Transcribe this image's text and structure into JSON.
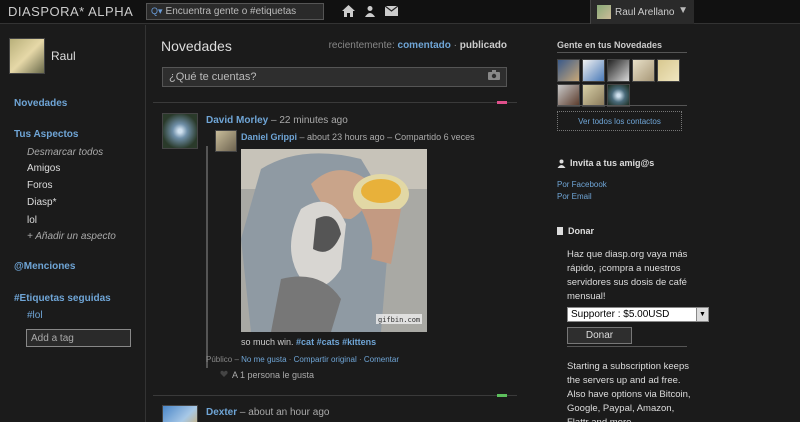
{
  "header": {
    "brand": "DIASPORA* ALPHA",
    "search_placeholder": "Encuentra gente o #etiquetas",
    "user_name": "Raul Arellano"
  },
  "left": {
    "profile_name": "Raul",
    "nav_stream": "Novedades",
    "aspects_title": "Tus Aspectos",
    "deselect_all": "Desmarcar todos",
    "aspects": [
      "Amigos",
      "Foros",
      "Diasp*",
      "lol"
    ],
    "add_aspect": "+ Añadir un aspecto",
    "mentions": "@Menciones",
    "followed_tags_title": "#Etiquetas seguidas",
    "followed_tag": "#lol",
    "add_tag_placeholder": "Add a tag"
  },
  "main": {
    "title": "Novedades",
    "sort_label": "recientemente:",
    "sort_commented": "comentado",
    "sort_sep": "·",
    "sort_published": "publicado",
    "composer_placeholder": "¿Qué te cuentas?",
    "post1": {
      "author": "David Morley",
      "time": "– 22 minutes ago",
      "reshare_author": "Daniel Grippi",
      "reshare_meta": "– about 23 hours ago – Compartido 6 veces",
      "caption_text": "so much win.",
      "tags": [
        "#cat",
        "#cats",
        "#kittens"
      ],
      "watermark": "gifbin.com",
      "visibility": "Público –",
      "action_unlike": "No me gusta",
      "action_reshare": "Compartir original",
      "action_comment": "Comentar",
      "likes_text": "A 1 persona le gusta"
    },
    "post2": {
      "author": "Dexter",
      "time": "– about an hour ago"
    }
  },
  "right": {
    "contacts_title": "Gente en tus Novedades",
    "view_all_contacts": "Ver todos los contactos",
    "invite_title": "Invita a tus amig@s",
    "invite_facebook": "Por Facebook",
    "invite_email": "Por Email",
    "donate_title": "Donar",
    "donate_text": "Haz que diasp.org vaya más rápido, ¡compra a nuestros servidores sus dosis de café mensual!",
    "donate_option": "Supporter : $5.00USD",
    "donate_button": "Donar",
    "subscription_text": "Starting a subscription keeps the servers up and ad free. Also have options via Bitcoin, Google, Paypal, Amazon, Flattr and more"
  },
  "colors": {
    "accent_link": "#6fa5d6",
    "background": "#1b1b1b",
    "post_mark_pink": "#e0508c",
    "post_mark_green": "#5cbf5c"
  }
}
